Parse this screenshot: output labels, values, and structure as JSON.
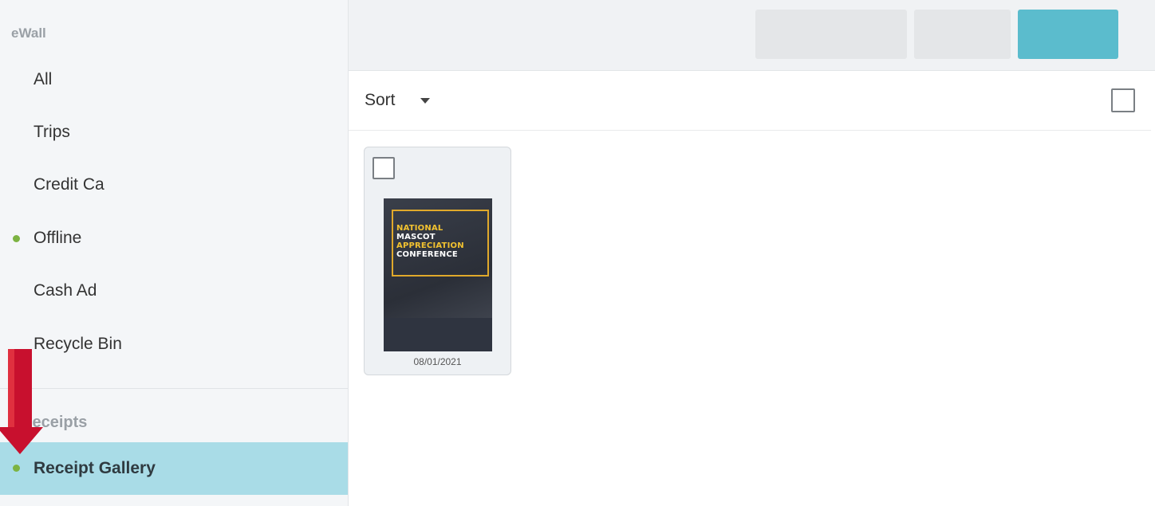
{
  "sidebar": {
    "heading": "eWall",
    "items": [
      {
        "label": "All",
        "dot": false
      },
      {
        "label": "Trips",
        "dot": false
      },
      {
        "label": "Credit Ca",
        "dot": false
      },
      {
        "label": "Offline",
        "dot": true
      },
      {
        "label": "Cash Ad",
        "dot": false
      },
      {
        "label": "Recycle Bin",
        "dot": false
      }
    ],
    "section_heading": "Receipts",
    "active_item": {
      "label": "Receipt Gallery",
      "dot": true
    }
  },
  "toolbar": {
    "buttons": [
      "",
      "",
      ""
    ]
  },
  "sort": {
    "label": "Sort"
  },
  "receipts": [
    {
      "thumb_lines": [
        "NATIONAL",
        "MASCOT",
        "APPRECIATION",
        "CONFERENCE"
      ],
      "date": "08/01/2021"
    }
  ],
  "colors": {
    "active_bg": "#a9dce7",
    "status_dot": "#7cb342",
    "primary_button": "#5bbccd",
    "arrow": "#c8102e"
  }
}
